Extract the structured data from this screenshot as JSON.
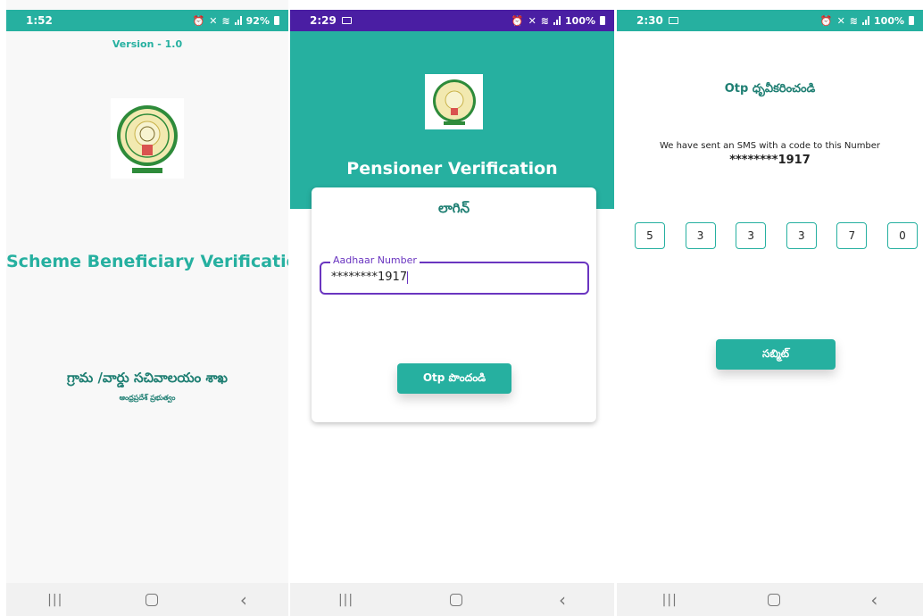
{
  "screens": [
    {
      "status": {
        "time": "1:52",
        "battery": "92%"
      },
      "version": "Version - 1.0",
      "app_title": "Scheme Beneficiary Verification",
      "department": "గ్రామ /వార్డు సచివాలయం శాఖ",
      "government": "ఆంధ్రప్రదేశ్ ప్రభుత్వం"
    },
    {
      "status": {
        "time": "2:29",
        "battery": "100%"
      },
      "app_title": "Pensioner Verification",
      "login": {
        "title": "లాగిన్",
        "aadhaar_label": "Aadhaar Number",
        "aadhaar_value": "********1917",
        "otp_button": "Otp పొందండి"
      }
    },
    {
      "status": {
        "time": "2:30",
        "battery": "100%"
      },
      "title": "Otp ధృవీకరించండి",
      "sms_message": "We have sent an SMS with a code to this Number",
      "masked_number": "********1917",
      "otp_digits": [
        "5",
        "3",
        "3",
        "3",
        "7",
        "0"
      ],
      "submit_button": "సబ్మిట్"
    }
  ],
  "colors": {
    "teal": "#26b0a0",
    "purple": "#4a1ea3",
    "dark_teal": "#1f7f73"
  },
  "icons": [
    "alarm-icon",
    "mute-icon",
    "wifi-icon",
    "signal-icon",
    "battery-icon",
    "gallery-icon",
    "nav-recent-icon",
    "nav-home-icon",
    "nav-back-icon"
  ]
}
